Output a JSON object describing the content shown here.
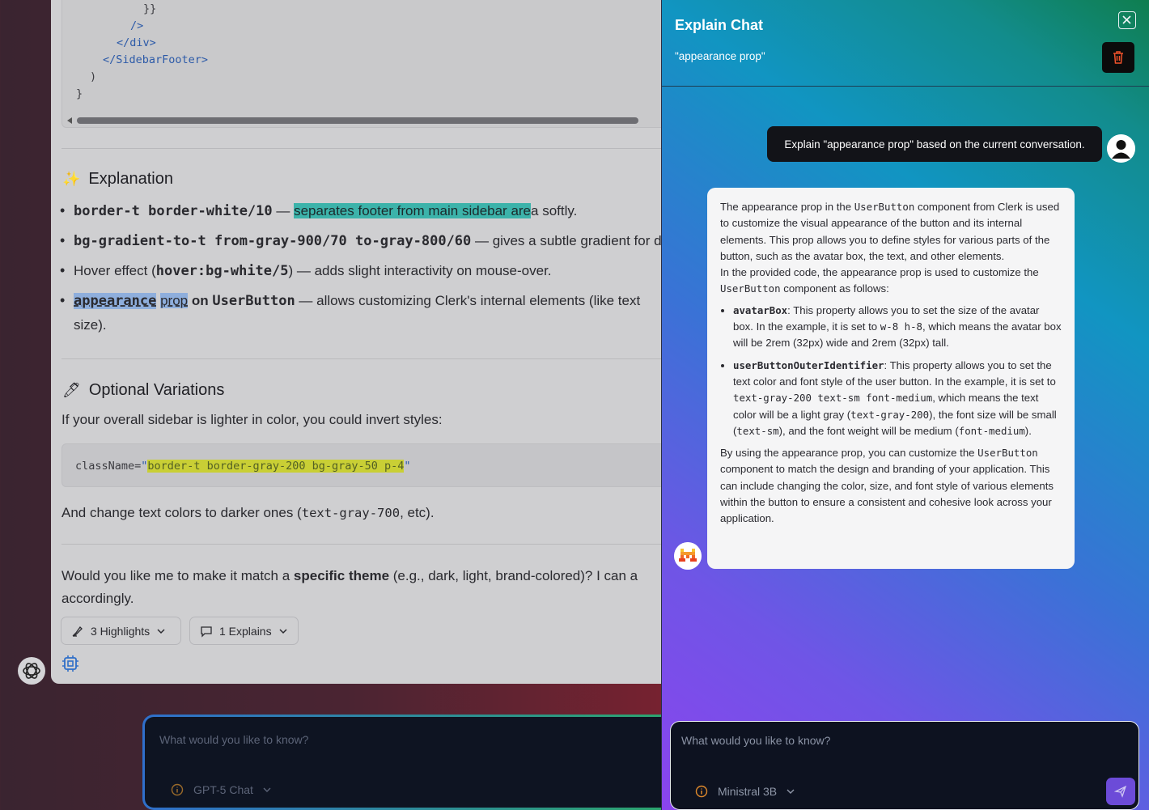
{
  "main": {
    "code": {
      "lines": [
        "}}",
        "/>",
        "</div>",
        "</SidebarFooter>",
        ")",
        "}"
      ]
    },
    "explanation": {
      "icon": "sparkles-icon",
      "heading": "Explanation",
      "items": [
        {
          "code": "border-t border-white/10",
          "dash": " — ",
          "highlighted": "separates footer from main sidebar are",
          "rest": "a softly."
        },
        {
          "code": "bg-gradient-to-t from-gray-900/70 to-gray-800/60",
          "rest": " — gives a subtle gradient for d"
        },
        {
          "pre": "Hover effect (",
          "code": "hover:bg-white/5",
          "rest": ") — adds slight interactivity on mouse-over."
        },
        {
          "highlighted_a": "appearance",
          "highlighted_b": "prop",
          "mid": " on ",
          "code": "UserButton",
          "rest": " — allows customizing Clerk's internal elements (like text",
          "cont": "size)."
        }
      ]
    },
    "variations": {
      "icon": "pen-icon",
      "heading": "Optional Variations",
      "intro": "If your overall sidebar is lighter in color, you could invert styles:",
      "code_attr": "className=",
      "code_q": "\"",
      "code_value": "border-t border-gray-200 bg-gray-50 p-4",
      "after_pre": "And change text colors to darker ones (",
      "after_code": "text-gray-700",
      "after_post": ", etc)."
    },
    "question": {
      "pre": "Would you like me to make it match a ",
      "bold": "specific theme",
      "post": " (e.g., dark, light, brand-colored)? I can a",
      "cont": "accordingly."
    },
    "pills": {
      "highlights": "3 Highlights",
      "explains": "1 Explains"
    },
    "input": {
      "placeholder": "What would you like to know?",
      "model": "GPT-5 Chat"
    }
  },
  "panel": {
    "title": "Explain Chat",
    "subtitle": "\"appearance prop\"",
    "user_message": "Explain \"appearance prop\" based on the current conversation.",
    "bot": {
      "p1_a": "The appearance prop in the ",
      "p1_code": "UserButton",
      "p1_b": " component from Clerk is used to customize the visual appearance of the button and its internal elements. This prop allows you to define styles for various parts of the button, such as the avatar box, the text, and other elements.",
      "p2_a": "In the provided code, the appearance prop is used to customize the ",
      "p2_code": "UserButton",
      "p2_b": " component as follows:",
      "li1_code": "avatarBox",
      "li1_a": ": This property allows you to set the size of the avatar box. In the example, it is set to ",
      "li1_code2": "w-8 h-8",
      "li1_b": ", which means the avatar box will be 2rem (32px) wide and 2rem (32px) tall.",
      "li2_code": "userButtonOuterIdentifier",
      "li2_a": ": This property allows you to set the text color and font style of the user button. In the example, it is set to ",
      "li2_code2": "text-gray-200 text-sm font-medium",
      "li2_b": ", which means the text color will be a light gray (",
      "li2_code3": "text-gray-200",
      "li2_c": "), the font size will be small (",
      "li2_code4": "text-sm",
      "li2_d": "), and the font weight will be medium (",
      "li2_code5": "font-medium",
      "li2_e": ").",
      "p3_a": "By using the appearance prop, you can customize the ",
      "p3_code": "UserButton",
      "p3_b": " component to match the design and branding of your application. This can include changing the color, size, and font style of various elements within the button to ensure a consistent and cohesive look across your application."
    },
    "input": {
      "placeholder": "What would you like to know?",
      "model": "Ministral 3B"
    }
  },
  "colors": {
    "teal_highlight": "#3cb3aa",
    "blue_highlight": "#8eaedc",
    "yellow_highlight": "#c9cf35",
    "send_button": "#6c4bd8",
    "info_orange": "#e08a2c"
  }
}
